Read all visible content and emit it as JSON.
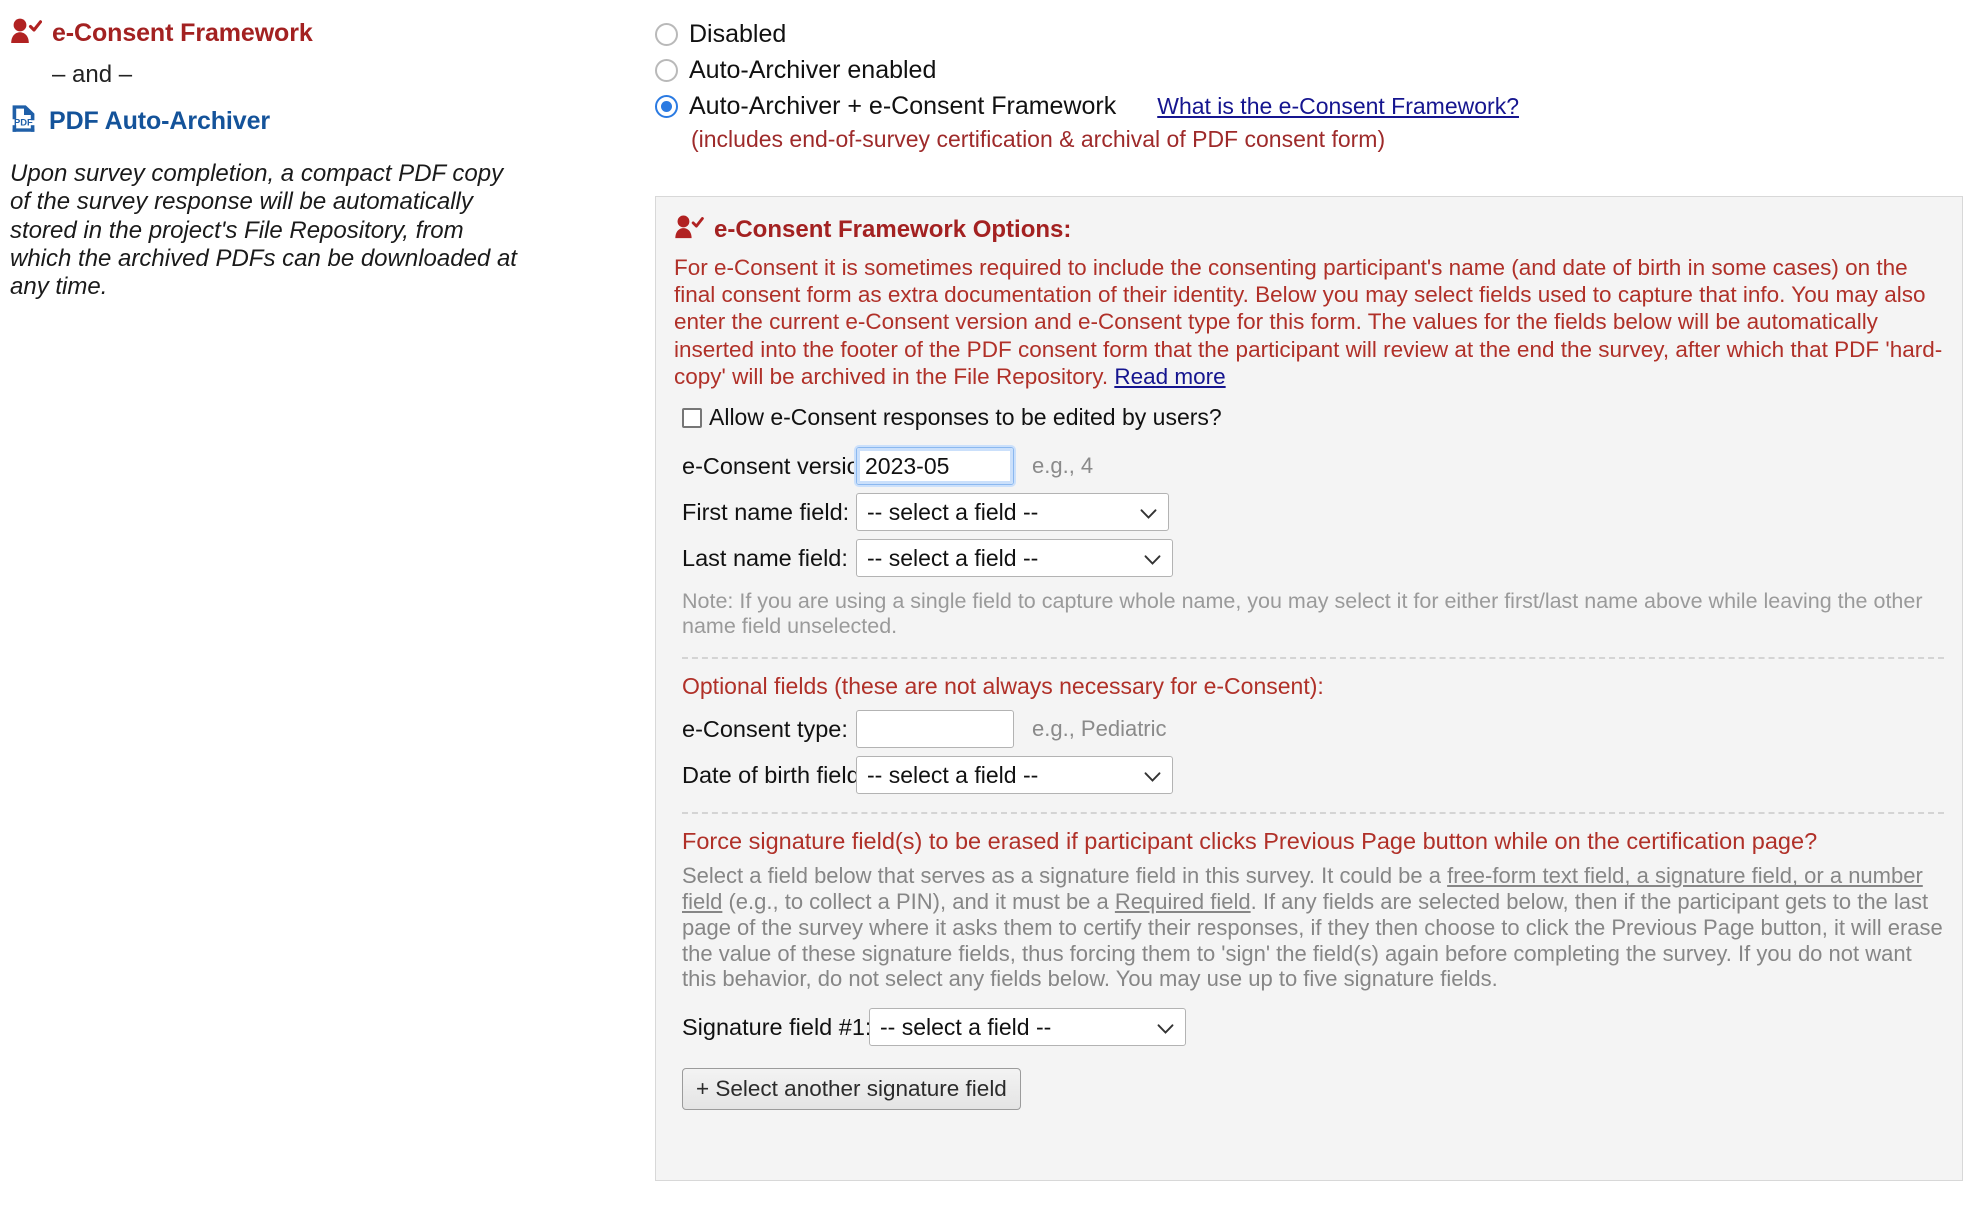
{
  "left": {
    "title_econsent": "e-Consent Framework",
    "and_text": "– and –",
    "title_pdf": "PDF Auto-Archiver",
    "description": "Upon survey completion, a compact PDF copy of the survey response will be automatically stored in the project's File Repository, from which the archived PDFs can be downloaded at any time.",
    "icon_user_check": "user-check-icon",
    "icon_pdf": "pdf-file-icon"
  },
  "radios": {
    "options": [
      {
        "label": "Disabled",
        "checked": false
      },
      {
        "label": "Auto-Archiver enabled",
        "checked": false
      },
      {
        "label": "Auto-Archiver + e-Consent Framework",
        "checked": true
      }
    ],
    "help_link": "What is the e-Consent Framework?",
    "subnote": "(includes end-of-survey certification & archival of PDF consent form)"
  },
  "panel": {
    "heading": "e-Consent Framework Options:",
    "description_main": "For e-Consent it is sometimes required to include the consenting participant's name (and date of birth in some cases) on the final consent form as extra documentation of their identity. Below you may select fields used to capture that info. You may also enter the current e-Consent version and e-Consent type for this form. The values for the fields below will be automatically inserted into the footer of the PDF consent form that the participant will review at the end the survey, after which that PDF 'hard-copy' will be archived in the File Repository. ",
    "read_more": "Read more",
    "allow_edit_label": "Allow e-Consent responses to be edited by users?",
    "allow_edit_checked": false,
    "version_label": "e-Consent version:",
    "version_value": "2023-05",
    "version_hint": "e.g., 4",
    "first_name_label": "First name field:",
    "first_name_value": "-- select a field --",
    "last_name_label": "Last name field:",
    "last_name_value": "-- select a field --",
    "name_note": "Note: If you are using a single field to capture whole name, you may select it for either first/last name above while leaving the other name field unselected.",
    "optional_heading": "Optional fields (these are not always necessary for e-Consent):",
    "type_label": "e-Consent type:",
    "type_value": "",
    "type_hint": "e.g., Pediatric",
    "dob_label": "Date of birth field:",
    "dob_value": "-- select a field --",
    "force_heading": "Force signature field(s) to be erased if participant clicks Previous Page button while on the certification page?",
    "sig_desc_1": "Select a field below that serves as a signature field in this survey. It could be a ",
    "sig_link_1": "free-form text field, a signature field, or a number field",
    "sig_desc_2": " (e.g., to collect a PIN), and it must be a ",
    "sig_link_2": "Required field",
    "sig_desc_3": ". If any fields are selected below, then if the participant gets to the last page of the survey where it asks them to certify their responses, if they then choose to click the Previous Page button, it will erase the value of these signature fields, thus forcing them to 'sign' the field(s) again before completing the survey. If you do not want this behavior, do not select any fields below. You may use up to five signature fields.",
    "signature_label": "Signature field #1:",
    "signature_value": "-- select a field --",
    "add_signature_button": "+ Select another signature field"
  },
  "colors": {
    "red": "#A32121",
    "red_text": "#B03028",
    "blue": "#14539A",
    "link": "#15158f",
    "accent_radio": "#2a7ae2",
    "panel_bg": "#f4f4f4",
    "gray_text": "#8a8a8a"
  }
}
